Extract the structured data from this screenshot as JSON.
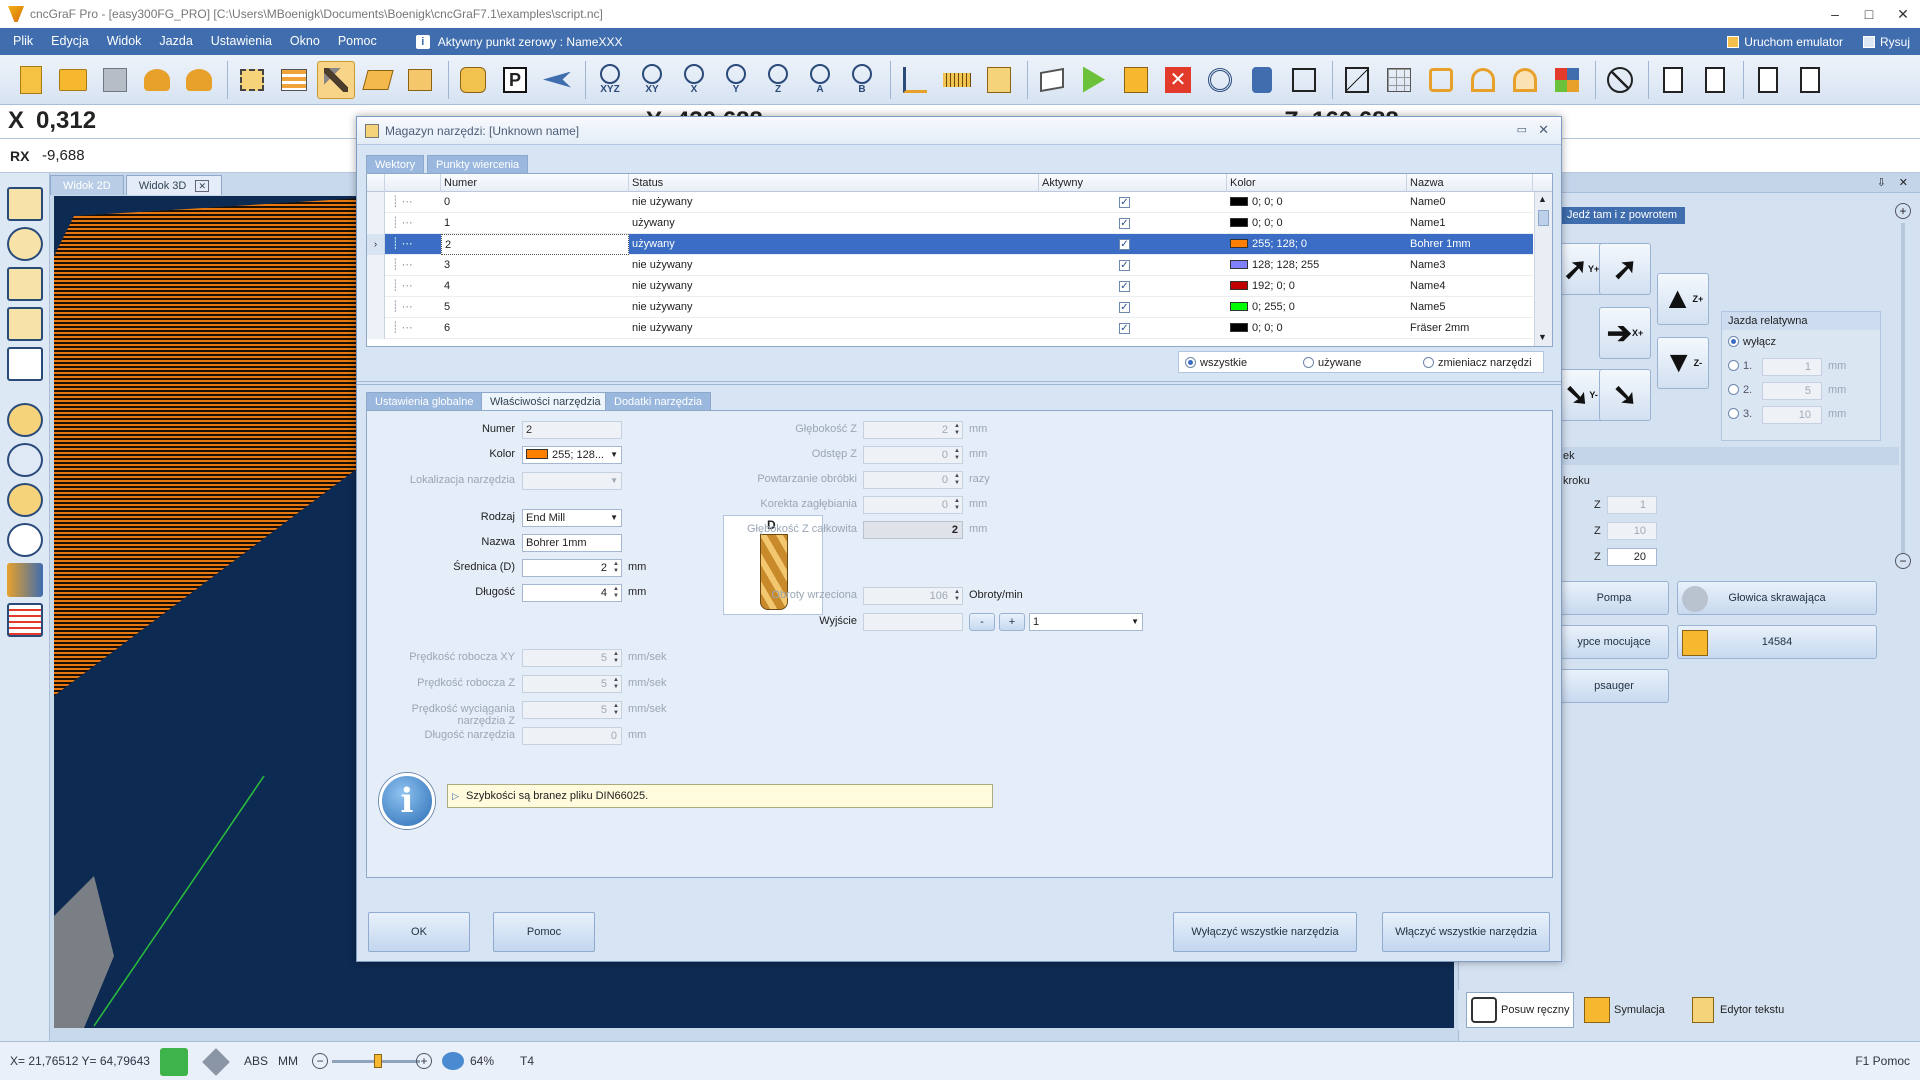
{
  "window": {
    "title": "cncGraF Pro - [easy300FG_PRO] [C:\\Users\\MBoenigk\\Documents\\Boenigk\\cncGraF7.1\\examples\\script.nc]"
  },
  "menu": {
    "items": [
      "Plik",
      "Edycja",
      "Widok",
      "Jazda",
      "Ustawienia",
      "Okno",
      "Pomoc"
    ],
    "zero_point": "Aktywny punkt zerowy : NameXXX",
    "emulator": "Uruchom emulator",
    "draw": "Rysuj"
  },
  "toolbar": {
    "axis_labels": [
      "XYZ",
      "XY",
      "X",
      "Y",
      "Z",
      "A",
      "B"
    ]
  },
  "coords": {
    "x_label": "X",
    "x_value": "0,312",
    "y_label": "Y",
    "y_value": "430,688",
    "z_label": "Z",
    "z_value": "160,688",
    "rx_label": "RX",
    "rx_value": "-9,688"
  },
  "view_tabs": [
    "Widok 2D",
    "Widok 3D"
  ],
  "dialog": {
    "title": "Magazyn narzędzi: [Unknown name]",
    "top_tabs": [
      "Wektory",
      "Punkty wiercenia"
    ],
    "columns": [
      "Numer",
      "Status",
      "Aktywny",
      "Kolor",
      "Nazwa"
    ],
    "rows": [
      {
        "numer": "0",
        "status": "nie używany",
        "kolor": "0; 0; 0",
        "swatch": "#000000",
        "nazwa": "Name0"
      },
      {
        "numer": "1",
        "status": "używany",
        "kolor": "0; 0; 0",
        "swatch": "#000000",
        "nazwa": "Name1"
      },
      {
        "numer": "2",
        "status": "używany",
        "kolor": "255; 128; 0",
        "swatch": "#ff8000",
        "nazwa": "Bohrer 1mm"
      },
      {
        "numer": "3",
        "status": "nie używany",
        "kolor": "128; 128; 255",
        "swatch": "#8080ff",
        "nazwa": "Name3"
      },
      {
        "numer": "4",
        "status": "nie używany",
        "kolor": "192; 0; 0",
        "swatch": "#c00000",
        "nazwa": "Name4"
      },
      {
        "numer": "5",
        "status": "nie używany",
        "kolor": "0; 255; 0",
        "swatch": "#00ff00",
        "nazwa": "Name5"
      },
      {
        "numer": "6",
        "status": "nie używany",
        "kolor": "0; 0; 0",
        "swatch": "#000000",
        "nazwa": "Fräser 2mm"
      }
    ],
    "filters": [
      "wszystkie",
      "używane",
      "zmieniacz narzędzi"
    ],
    "prop_tabs": [
      "Ustawienia globalne",
      "Właściwości narzędzia",
      "Dodatki narzędzia"
    ],
    "props": {
      "numer_label": "Numer",
      "numer_value": "2",
      "kolor_label": "Kolor",
      "kolor_value": "255; 128...",
      "lokalizacja_label": "Lokalizacja narzędzia",
      "rodzaj_label": "Rodzaj",
      "rodzaj_value": "End Mill",
      "nazwa_label": "Nazwa",
      "nazwa_value": "Bohrer 1mm",
      "srednica_label": "Średnica (D)",
      "srednica_value": "2",
      "dlugosc_label": "Długość",
      "dlugosc_value": "4",
      "mm": "mm",
      "mmsek": "mm/sek",
      "diagram_label": "D",
      "glebokosc_label": "Głębokość Z",
      "glebokosc_value": "2",
      "odstep_label": "Odstęp Z",
      "odstep_value": "0",
      "powt_label": "Powtarzanie obróbki",
      "powt_value": "0",
      "razy": "razy",
      "korekta_label": "Korekta zagłębiania",
      "korekta_value": "0",
      "glebcalk_label": "Głębokość Z całkowita",
      "glebcalk_value": "2",
      "obroty_label": "Obroty wrzeciona",
      "obroty_value": "106",
      "obroty_unit": "Obroty/min",
      "wyjscie_label": "Wyjście",
      "wyjscie_minus": "-",
      "wyjscie_plus": "+",
      "wyjscie_value": "1",
      "v_xy_label": "Prędkość robocza XY",
      "v_xy_value": "5",
      "v_z_label": "Prędkość robocza Z",
      "v_z_value": "5",
      "v_wyc_label": "Prędkość wyciągania narzędzia Z",
      "v_wyc_value": "5",
      "dl_narz_label": "Długość narzędzia",
      "dl_narz_value": "0"
    },
    "info": "Szybkości są branez pliku DIN66025.",
    "buttons": {
      "ok": "OK",
      "help": "Pomoc",
      "disable_all": "Wyłączyć wszystkie narzędzia",
      "enable_all": "Włączyć wszystkie narzędzia"
    }
  },
  "right_panel": {
    "tab": "Jedź tam i z powrotem",
    "arrow_labels": {
      "yplus": "Y+",
      "zplus": "Z+",
      "xplus": "X+",
      "yminus": "Y-",
      "zminus": "Z-"
    },
    "rel_title": "Jazda relatywna",
    "rel_off": "wyłącz",
    "rel_options": [
      {
        "label": "1.",
        "value": "1"
      },
      {
        "label": "2.",
        "value": "5"
      },
      {
        "label": "3.",
        "value": "10"
      }
    ],
    "section2": "ek",
    "krok_label": "kroku",
    "z_rows": [
      {
        "label": "Z",
        "value": "1"
      },
      {
        "label": "Z",
        "value": "10"
      },
      {
        "label": "Z",
        "value": "20"
      }
    ],
    "buttons": [
      "Pompa",
      "Głowica skrawająca",
      "ypce mocujące",
      "14584",
      "psauger"
    ]
  },
  "bottom_tabs": [
    "Posuw ręczny",
    "Symulacja",
    "Edytor tekstu"
  ],
  "status": {
    "coords": "X= 21,76512 Y= 64,79643",
    "abs": "ABS",
    "mm": "MM",
    "zoom": "64%",
    "tool": "T4",
    "help": "F1 Pomoc"
  }
}
